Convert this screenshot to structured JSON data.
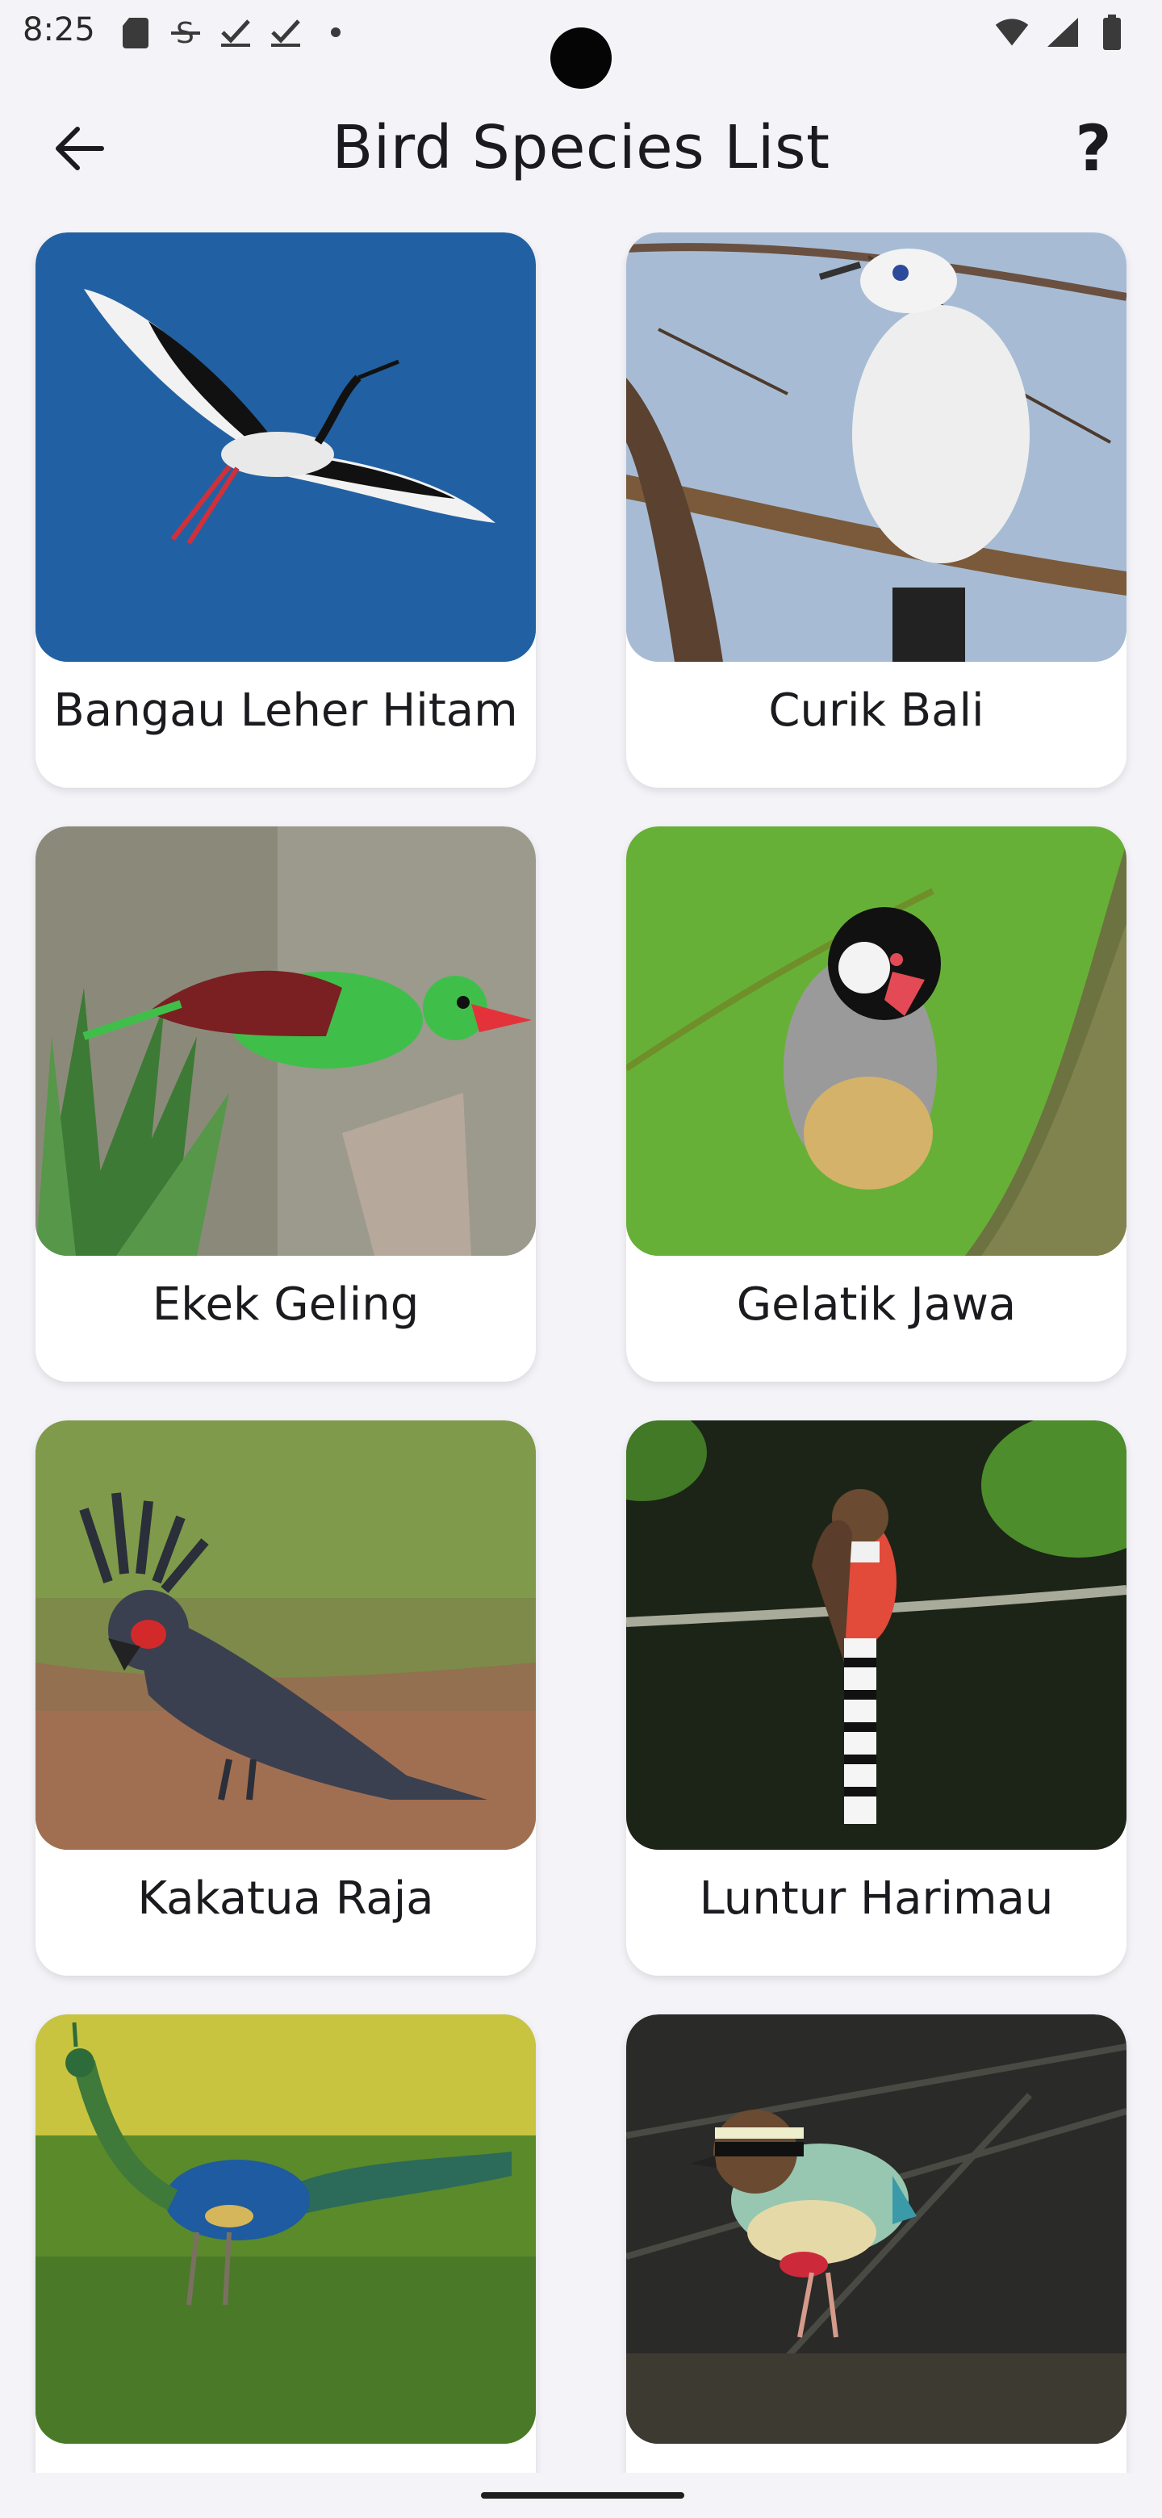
{
  "status_bar": {
    "time": "8:25",
    "left_icons": [
      "sd-card-icon",
      "strikethrough-s-icon",
      "check-download-icon",
      "check-download-icon",
      "dot-icon"
    ],
    "right_icons": [
      "wifi-icon",
      "signal-icon",
      "battery-icon"
    ]
  },
  "app_bar": {
    "title": "Bird Species List",
    "back_icon": "arrow-left-icon",
    "help_label": "?"
  },
  "birds": [
    {
      "name": "Bangau Leher Hitam"
    },
    {
      "name": "Curik Bali"
    },
    {
      "name": "Ekek Geling"
    },
    {
      "name": "Gelatik Jawa"
    },
    {
      "name": "Kakatua Raja"
    },
    {
      "name": "Luntur Harimau"
    },
    {
      "name": ""
    },
    {
      "name": ""
    }
  ],
  "colors": {
    "background": "#f4f3f8",
    "card": "#ffffff",
    "text": "#1b1b1f"
  }
}
